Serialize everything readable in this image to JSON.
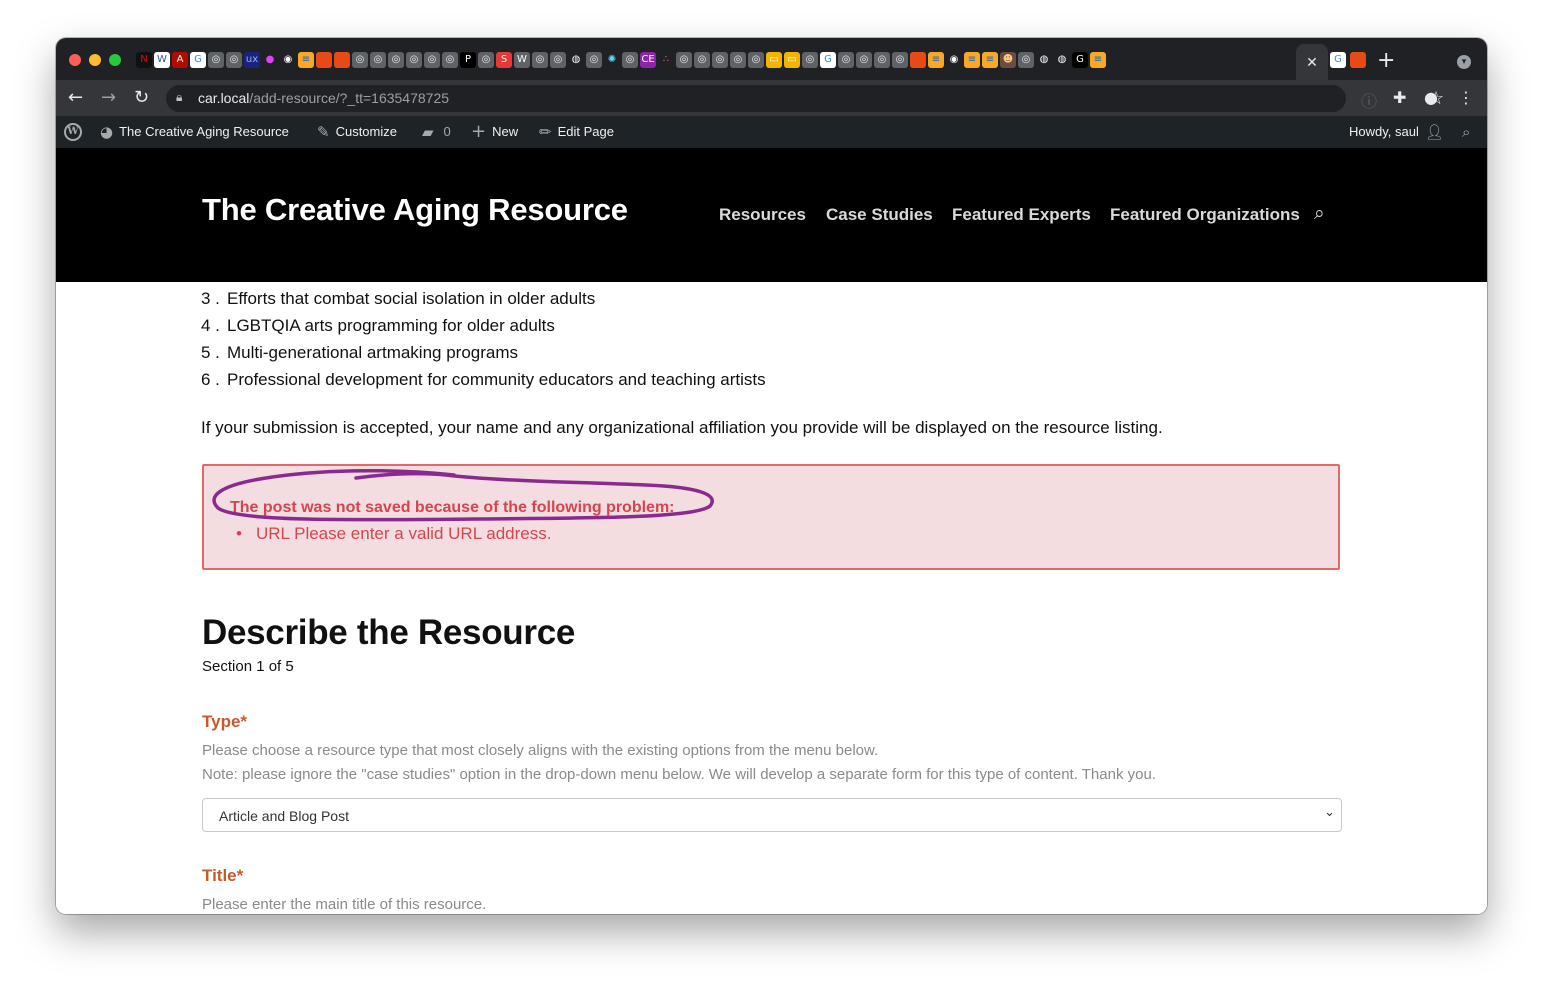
{
  "browser": {
    "url_host": "car.local",
    "url_path": "/add-resource/?_tt=1635478725",
    "active_tab_close": "✕",
    "new_tab": "+",
    "favicons": [
      {
        "icon": "netflix-icon",
        "glyph": "N",
        "color": "#111111",
        "fg": "#e50914"
      },
      {
        "icon": "word-icon",
        "glyph": "W",
        "color": "#ffffff",
        "fg": "#2b579a"
      },
      {
        "icon": "acrobat-icon",
        "glyph": "A",
        "color": "#b30b00",
        "fg": "#ffffff"
      },
      {
        "icon": "google-icon",
        "glyph": "G",
        "color": "#ffffff",
        "fg": "#4285f4"
      },
      {
        "icon": "globe-icon",
        "glyph": "◎",
        "color": "#5f6368",
        "fg": "#e8eaed"
      },
      {
        "icon": "globe-icon",
        "glyph": "◎",
        "color": "#5f6368",
        "fg": "#e8eaed"
      },
      {
        "icon": "ux-icon",
        "glyph": "ux",
        "color": "#1a237e",
        "fg": "#8ab4f8"
      },
      {
        "icon": "color-wheel-icon",
        "glyph": "●",
        "color": "#202124",
        "fg": "#e040fb"
      },
      {
        "icon": "github-icon",
        "glyph": "◉",
        "color": "#202124",
        "fg": "#ffffff"
      },
      {
        "icon": "stack-icon",
        "glyph": "≡",
        "color": "#f9a825",
        "fg": "#1565c0"
      },
      {
        "icon": "bookmark-icon",
        "glyph": "■",
        "color": "#e64a19",
        "fg": "#e64a19"
      },
      {
        "icon": "bookmark-icon",
        "glyph": "■",
        "color": "#e64a19",
        "fg": "#e64a19"
      },
      {
        "icon": "globe-icon",
        "glyph": "◎",
        "color": "#5f6368",
        "fg": "#e8eaed"
      },
      {
        "icon": "globe-icon",
        "glyph": "◎",
        "color": "#5f6368",
        "fg": "#e8eaed"
      },
      {
        "icon": "globe-icon",
        "glyph": "◎",
        "color": "#5f6368",
        "fg": "#e8eaed"
      },
      {
        "icon": "globe-icon",
        "glyph": "◎",
        "color": "#5f6368",
        "fg": "#e8eaed"
      },
      {
        "icon": "globe-icon",
        "glyph": "◎",
        "color": "#5f6368",
        "fg": "#e8eaed"
      },
      {
        "icon": "globe-icon",
        "glyph": "◎",
        "color": "#5f6368",
        "fg": "#e8eaed"
      },
      {
        "icon": "tp-icon",
        "glyph": "P",
        "color": "#000000",
        "fg": "#ffffff"
      },
      {
        "icon": "globe-icon",
        "glyph": "◎",
        "color": "#5f6368",
        "fg": "#e8eaed"
      },
      {
        "icon": "s-icon",
        "glyph": "S",
        "color": "#e53935",
        "fg": "#ffffff"
      },
      {
        "icon": "wordpress-icon",
        "glyph": "W",
        "color": "#5f6368",
        "fg": "#ffffff"
      },
      {
        "icon": "globe-icon",
        "glyph": "◎",
        "color": "#5f6368",
        "fg": "#e8eaed"
      },
      {
        "icon": "globe-icon",
        "glyph": "◎",
        "color": "#5f6368",
        "fg": "#e8eaed"
      },
      {
        "icon": "elephant-icon",
        "glyph": "◍",
        "color": "#202124",
        "fg": "#ffffff"
      },
      {
        "icon": "globe-icon",
        "glyph": "◎",
        "color": "#5f6368",
        "fg": "#e8eaed"
      },
      {
        "icon": "react-icon",
        "glyph": "✺",
        "color": "#202124",
        "fg": "#61dafb"
      },
      {
        "icon": "globe-icon",
        "glyph": "◎",
        "color": "#5f6368",
        "fg": "#e8eaed"
      },
      {
        "icon": "ce-icon",
        "glyph": "CE",
        "color": "#8e24aa",
        "fg": "#ffffff"
      },
      {
        "icon": "asana-icon",
        "glyph": "∴",
        "color": "#202124",
        "fg": "#f06a6a"
      },
      {
        "icon": "globe-icon",
        "glyph": "◎",
        "color": "#5f6368",
        "fg": "#e8eaed"
      },
      {
        "icon": "globe-icon",
        "glyph": "◎",
        "color": "#5f6368",
        "fg": "#e8eaed"
      },
      {
        "icon": "globe-icon",
        "glyph": "◎",
        "color": "#5f6368",
        "fg": "#e8eaed"
      },
      {
        "icon": "globe-icon",
        "glyph": "◎",
        "color": "#5f6368",
        "fg": "#e8eaed"
      },
      {
        "icon": "globe-icon",
        "glyph": "◎",
        "color": "#5f6368",
        "fg": "#e8eaed"
      },
      {
        "icon": "slides-icon",
        "glyph": "▭",
        "color": "#f4b400",
        "fg": "#ffffff"
      },
      {
        "icon": "slides-icon",
        "glyph": "▭",
        "color": "#f4b400",
        "fg": "#ffffff"
      },
      {
        "icon": "globe-icon",
        "glyph": "◎",
        "color": "#5f6368",
        "fg": "#e8eaed"
      },
      {
        "icon": "google-icon",
        "glyph": "G",
        "color": "#ffffff",
        "fg": "#4285f4"
      },
      {
        "icon": "globe-icon",
        "glyph": "◎",
        "color": "#5f6368",
        "fg": "#e8eaed"
      },
      {
        "icon": "globe-icon",
        "glyph": "◎",
        "color": "#5f6368",
        "fg": "#e8eaed"
      },
      {
        "icon": "globe-icon",
        "glyph": "◎",
        "color": "#5f6368",
        "fg": "#e8eaed"
      },
      {
        "icon": "globe-icon",
        "glyph": "◎",
        "color": "#5f6368",
        "fg": "#e8eaed"
      },
      {
        "icon": "bookmark-icon",
        "glyph": "■",
        "color": "#e64a19",
        "fg": "#e64a19"
      },
      {
        "icon": "stack-icon",
        "glyph": "≡",
        "color": "#f9a825",
        "fg": "#1565c0"
      },
      {
        "icon": "github-icon",
        "glyph": "◉",
        "color": "#202124",
        "fg": "#ffffff"
      },
      {
        "icon": "stack-icon",
        "glyph": "≡",
        "color": "#f9a825",
        "fg": "#1565c0"
      },
      {
        "icon": "stack-icon",
        "glyph": "≡",
        "color": "#f9a825",
        "fg": "#1565c0"
      },
      {
        "icon": "avatar-icon",
        "glyph": "☻",
        "color": "#6d4c41",
        "fg": "#ffcc80"
      },
      {
        "icon": "globe-icon",
        "glyph": "◎",
        "color": "#5f6368",
        "fg": "#e8eaed"
      },
      {
        "icon": "elephant-icon",
        "glyph": "◍",
        "color": "#202124",
        "fg": "#ffffff"
      },
      {
        "icon": "elephant-icon",
        "glyph": "◍",
        "color": "#202124",
        "fg": "#ffffff"
      },
      {
        "icon": "g-icon",
        "glyph": "G",
        "color": "#000000",
        "fg": "#ffffff"
      },
      {
        "icon": "stack-icon",
        "glyph": "≡",
        "color": "#f9a825",
        "fg": "#1565c0"
      }
    ],
    "favicons_after": [
      {
        "icon": "google-icon",
        "glyph": "G",
        "color": "#ffffff",
        "fg": "#4285f4"
      },
      {
        "icon": "bookmark-icon",
        "glyph": "■",
        "color": "#e64a19",
        "fg": "#e64a19"
      }
    ]
  },
  "adminbar": {
    "site_name": "The Creative Aging Resource",
    "customize": "Customize",
    "comments_count": "0",
    "new": "New",
    "edit_page": "Edit Page",
    "howdy": "Howdy, saul"
  },
  "site": {
    "title": "The Creative Aging Resource",
    "nav": [
      "Resources",
      "Case Studies",
      "Featured Experts",
      "Featured Organizations"
    ]
  },
  "content": {
    "list": [
      {
        "num": "3 .",
        "text": "Efforts that combat social isolation in older adults"
      },
      {
        "num": "4 .",
        "text": "LGBTQIA arts programming for older adults"
      },
      {
        "num": "5 .",
        "text": "Multi-generational artmaking programs"
      },
      {
        "num": "6 .",
        "text": "Professional development for community educators and teaching artists"
      }
    ],
    "notice": "If your submission is accepted, your name and any organizational affiliation you provide will be displayed on the resource listing.",
    "error_title": "The post was not saved because of the following problem:",
    "error_item": "URL Please enter a valid URL address.",
    "annotation_color": "#8b2a8e",
    "heading": "Describe the Resource",
    "section": "Section 1 of 5",
    "type_label": "Type",
    "required_mark": "*",
    "type_help_1": "Please choose a resource type that most closely aligns with the existing options from the menu below.",
    "type_help_2": "Note: please ignore the \"case studies\" option in the drop-down menu below. We will develop a separate form for this type of content. Thank you.",
    "type_value": "Article and Blog Post",
    "title_label": "Title",
    "title_help": "Please enter the main title of this resource."
  }
}
